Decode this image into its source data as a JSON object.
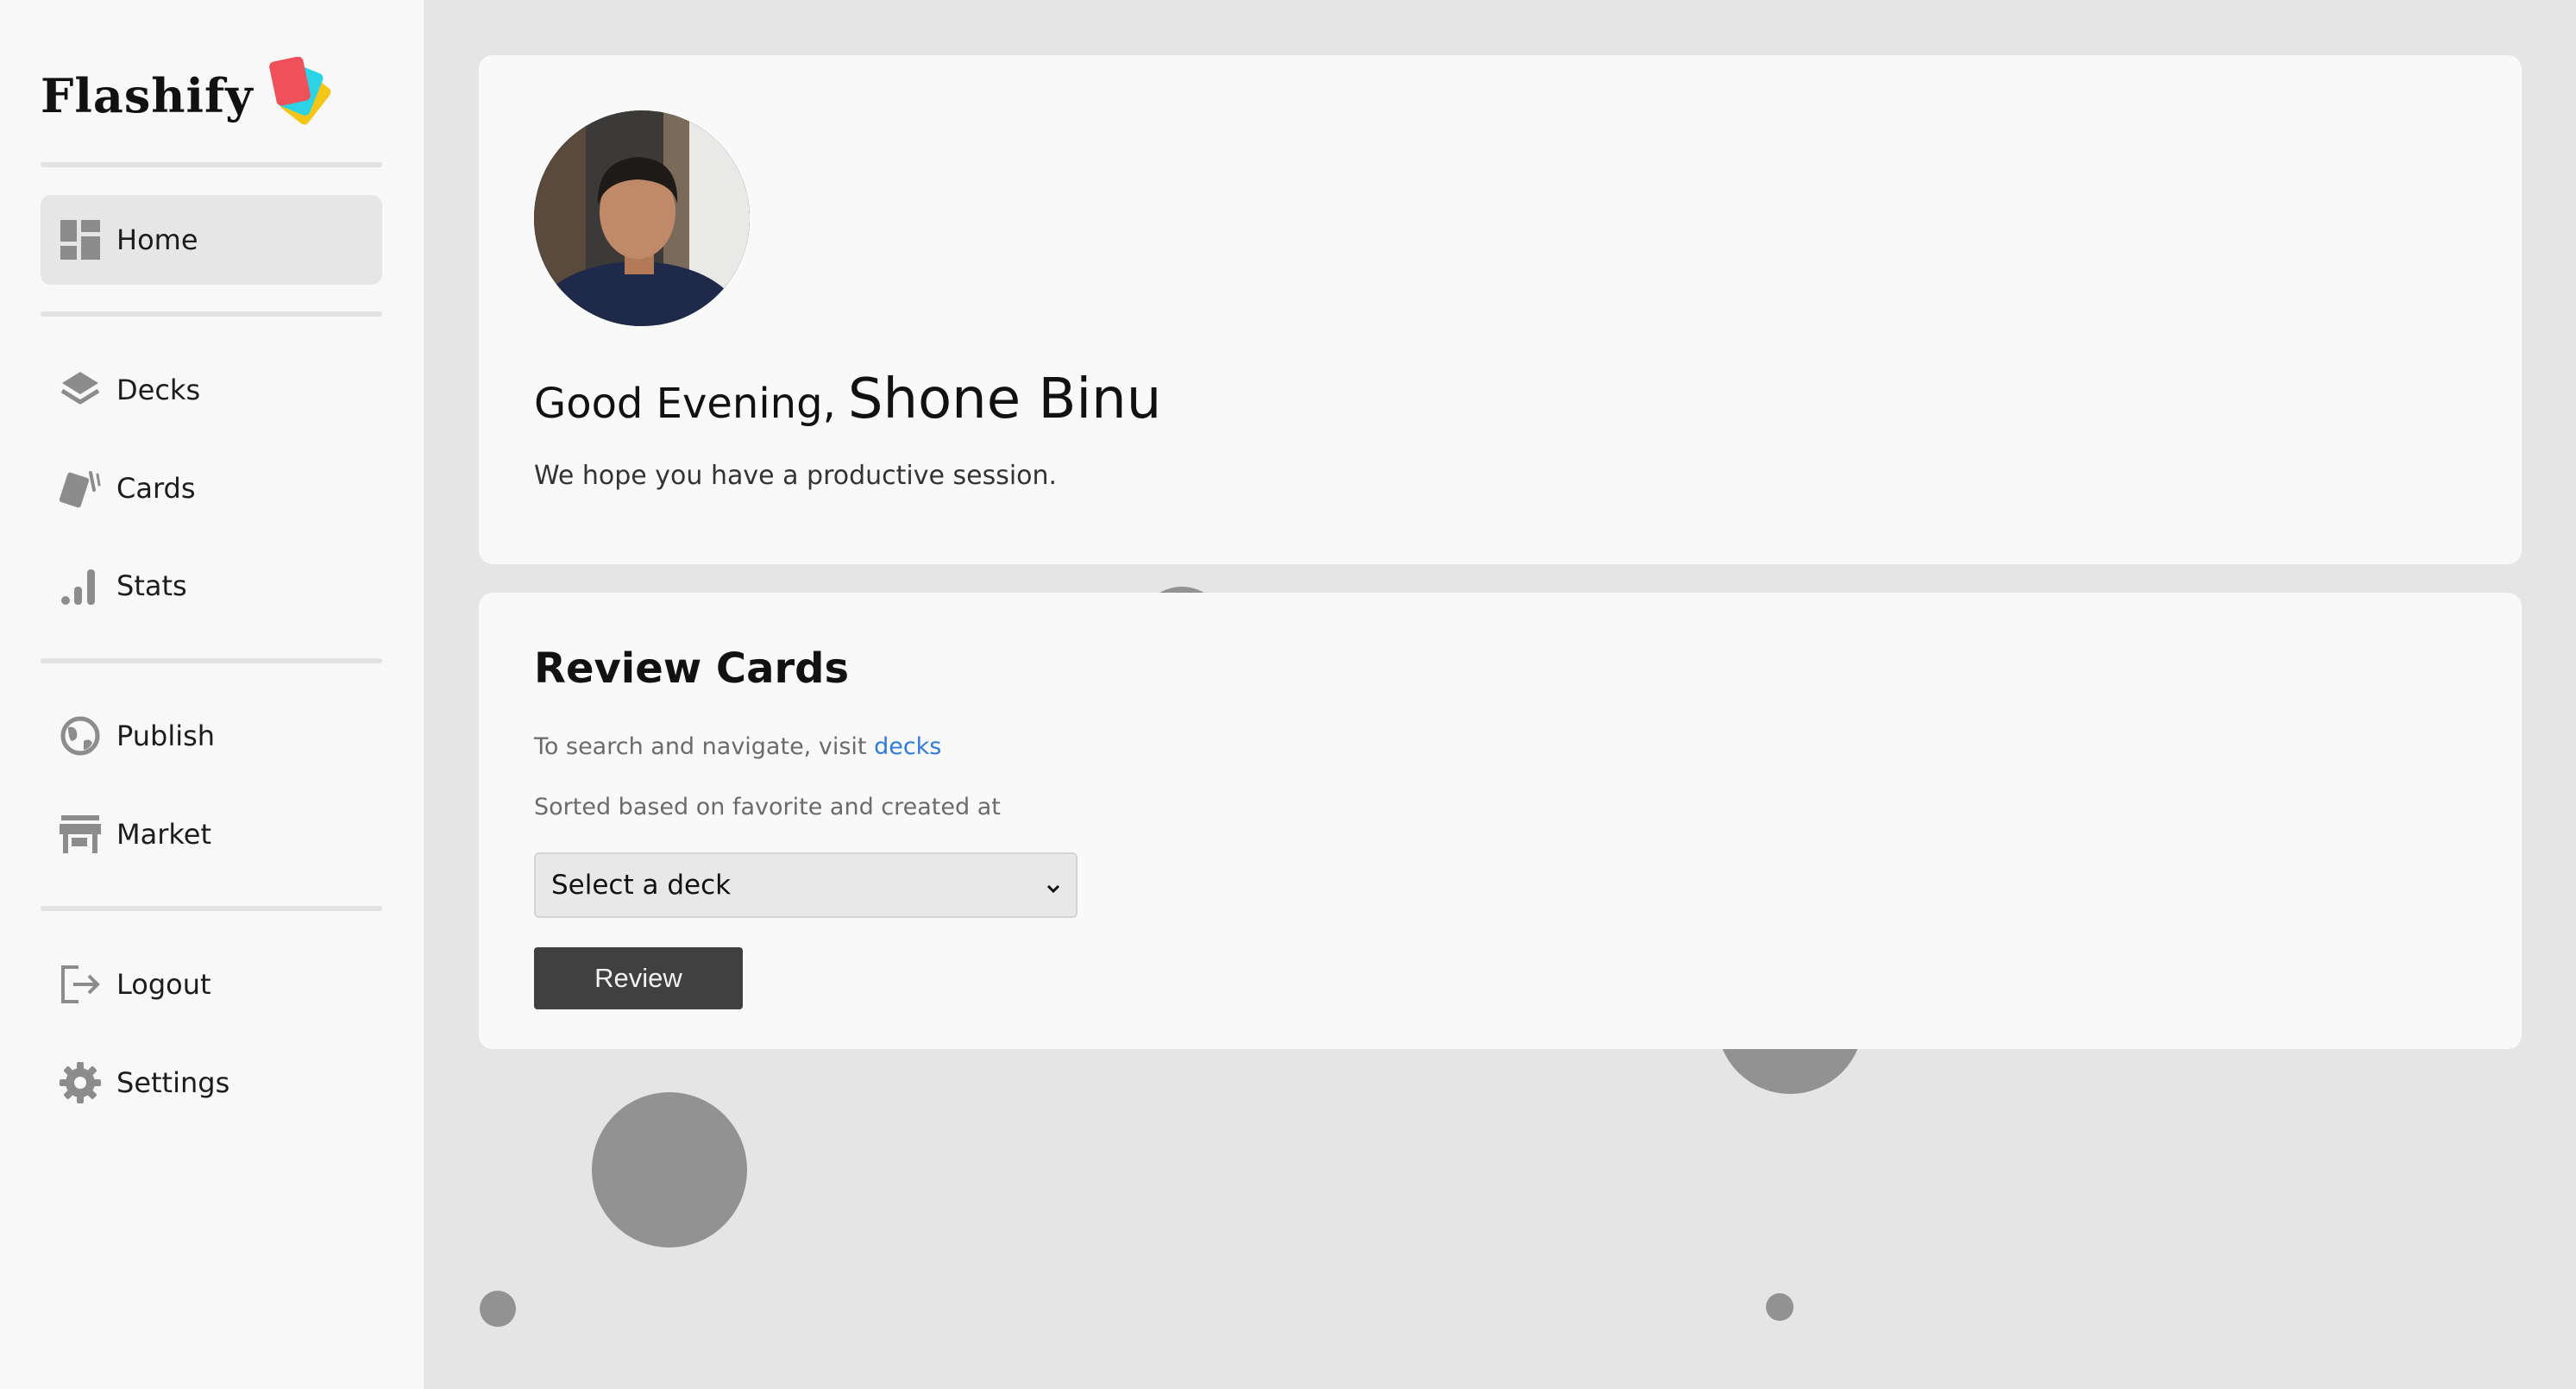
{
  "app": {
    "name": "Flashify"
  },
  "sidebar": {
    "items": [
      {
        "label": "Home",
        "icon": "dashboard-icon",
        "active": true
      },
      {
        "label": "Decks",
        "icon": "layers-icon"
      },
      {
        "label": "Cards",
        "icon": "cards-icon"
      },
      {
        "label": "Stats",
        "icon": "bar-chart-icon"
      },
      {
        "label": "Publish",
        "icon": "globe-icon"
      },
      {
        "label": "Market",
        "icon": "store-icon"
      },
      {
        "label": "Logout",
        "icon": "logout-icon"
      },
      {
        "label": "Settings",
        "icon": "gear-icon"
      }
    ]
  },
  "welcome": {
    "greeting": "Good Evening,",
    "name": "Shone Binu",
    "subtitle": "We hope you have a productive session."
  },
  "review": {
    "title": "Review Cards",
    "hint_prefix": "To search and navigate, visit",
    "hint_link": "decks",
    "sort_note": "Sorted based on favorite and created at",
    "select_value": "Select a deck",
    "button_label": "Review"
  },
  "colors": {
    "background": "#e5e5e5",
    "sidebar": "#f8f8f8",
    "card": "#f9f9f9",
    "link": "#2e7bd8",
    "button": "#404040",
    "bubble": "#929292"
  }
}
